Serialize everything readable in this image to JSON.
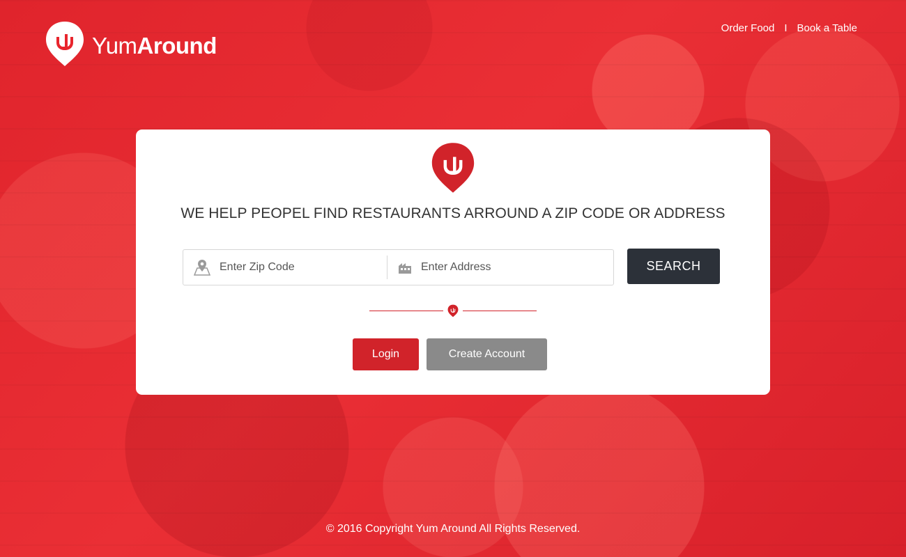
{
  "brand": {
    "name_light": "Yum",
    "name_bold": "Around",
    "logo_icon": "fork-pin-icon",
    "accent_color": "#d1232a"
  },
  "top_nav": {
    "items": [
      {
        "label": "Order Food"
      },
      {
        "label": "Book a Table"
      }
    ],
    "separator": "I"
  },
  "hero": {
    "tagline": "WE HELP PEOPEL FIND RESTAURANTS ARROUND A ZIP CODE OR ADDRESS"
  },
  "search": {
    "zip_placeholder": "Enter Zip Code",
    "zip_value": "",
    "zip_icon": "map-pin-icon",
    "address_placeholder": "Enter Address",
    "address_value": "",
    "address_icon": "building-icon",
    "button_label": "SEARCH",
    "button_color": "#2c3139"
  },
  "auth": {
    "login_label": "Login",
    "create_account_label": "Create Account"
  },
  "footer": {
    "copyright": "© 2016 Copyright Yum Around All Rights Reserved."
  }
}
